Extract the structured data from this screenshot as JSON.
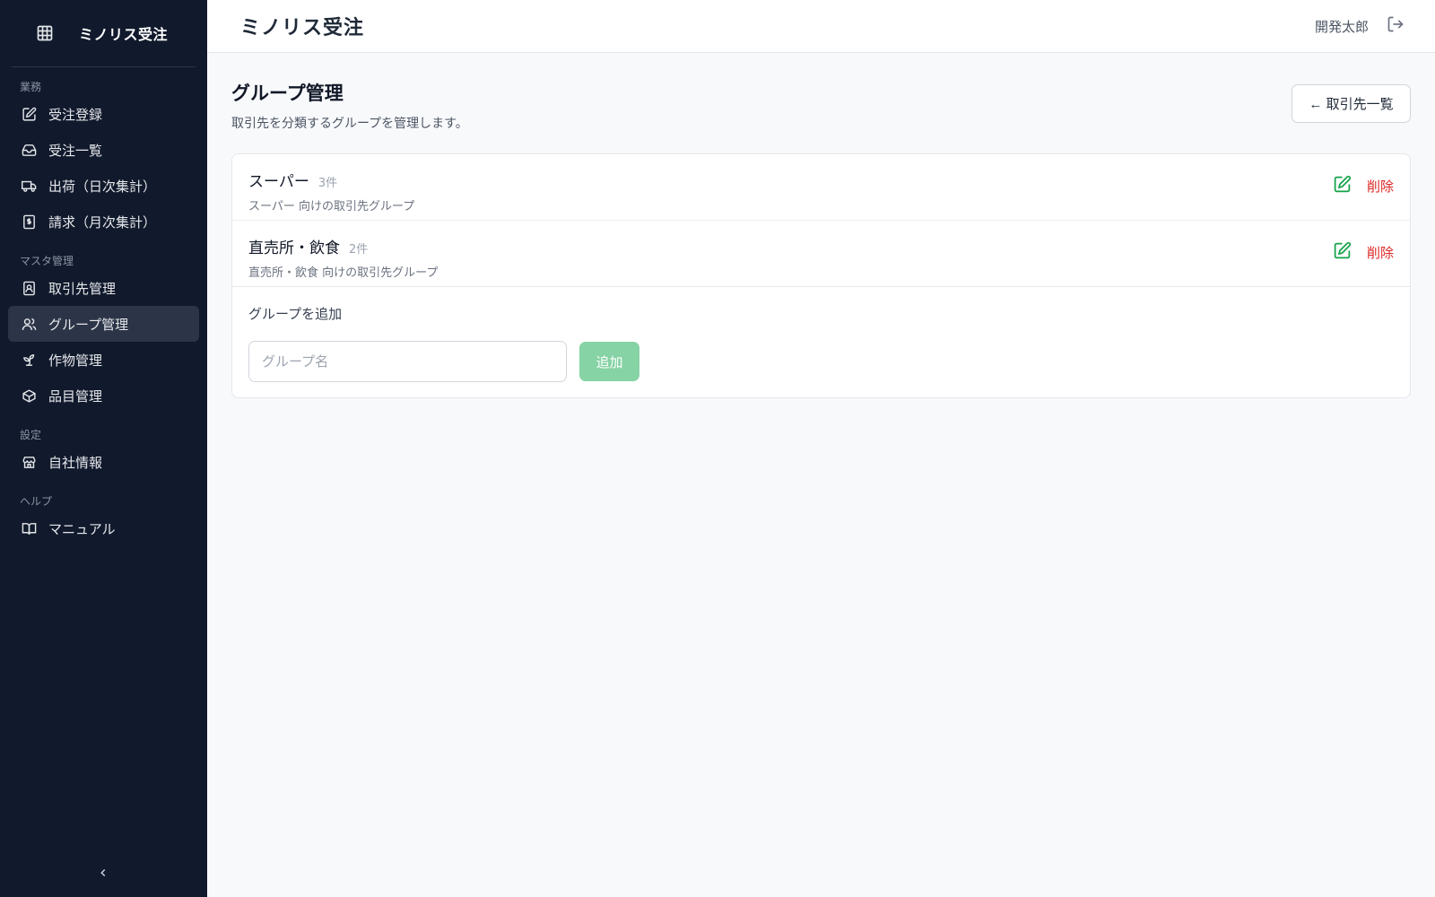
{
  "app": {
    "brand": "ミノリス受注",
    "header_title": "ミノリス受注",
    "user_name": "開発太郎"
  },
  "sidebar": {
    "sections": [
      {
        "label": "業務",
        "items": [
          {
            "label": "受注登録",
            "icon": "edit-icon"
          },
          {
            "label": "受注一覧",
            "icon": "inbox-icon"
          },
          {
            "label": "出荷（日次集計）",
            "icon": "truck-icon"
          },
          {
            "label": "請求（月次集計）",
            "icon": "receipt-icon"
          }
        ]
      },
      {
        "label": "マスタ管理",
        "items": [
          {
            "label": "取引先管理",
            "icon": "contact-icon"
          },
          {
            "label": "グループ管理",
            "icon": "users-icon",
            "active": true
          },
          {
            "label": "作物管理",
            "icon": "sprout-icon"
          },
          {
            "label": "品目管理",
            "icon": "package-icon"
          }
        ]
      },
      {
        "label": "設定",
        "items": [
          {
            "label": "自社情報",
            "icon": "store-icon"
          }
        ]
      },
      {
        "label": "ヘルプ",
        "items": [
          {
            "label": "マニュアル",
            "icon": "book-icon"
          }
        ]
      }
    ]
  },
  "page": {
    "title": "グループ管理",
    "subtitle": "取引先を分類するグループを管理します。",
    "back_button": "← 取引先一覧"
  },
  "groups": [
    {
      "name": "スーパー",
      "count": "3件",
      "description": "スーパー 向けの取引先グループ",
      "edit_icon": "edit-icon",
      "delete_label": "削除"
    },
    {
      "name": "直売所・飲食",
      "count": "2件",
      "description": "直売所・飲食 向けの取引先グループ",
      "edit_icon": "edit-icon",
      "delete_label": "削除"
    }
  ],
  "add_form": {
    "label": "グループを追加",
    "placeholder": "グループ名",
    "value": "",
    "button_label": "追加"
  },
  "colors": {
    "sidebar_bg": "#111a2c",
    "active_item_bg": "#2c3547",
    "accent_green": "#16a34a",
    "add_button_bg": "#86d3a5",
    "delete_red": "#dc2626"
  }
}
